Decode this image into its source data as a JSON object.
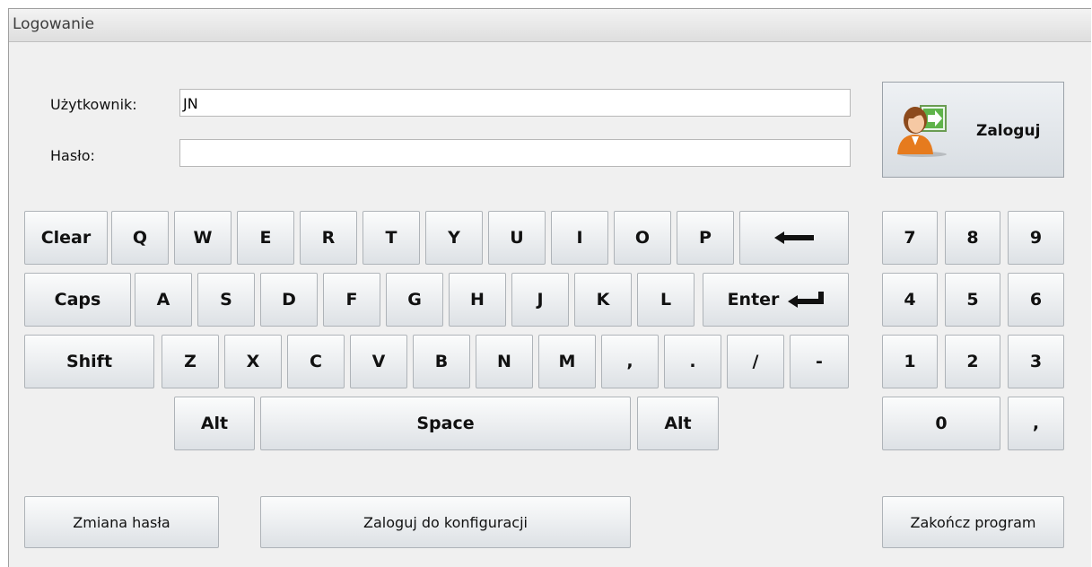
{
  "window": {
    "title": "Logowanie"
  },
  "form": {
    "user_label": "Użytkownik:",
    "user_value": "JN",
    "password_label": "Hasło:",
    "password_value": ""
  },
  "login_button": {
    "label": "Zaloguj",
    "icon": "user-login-icon"
  },
  "keyboard": {
    "row1": [
      "Clear",
      "Q",
      "W",
      "E",
      "R",
      "T",
      "Y",
      "U",
      "I",
      "O",
      "P"
    ],
    "backspace_icon": "backspace-arrow-icon",
    "row2": [
      "Caps",
      "A",
      "S",
      "D",
      "F",
      "G",
      "H",
      "J",
      "K",
      "L",
      "Enter"
    ],
    "enter_icon": "enter-arrow-icon",
    "row3": [
      "Shift",
      "Z",
      "X",
      "C",
      "V",
      "B",
      "N",
      "M",
      ",",
      ".",
      "/",
      "-"
    ],
    "row4": [
      "Alt",
      "Space",
      "Alt"
    ]
  },
  "numpad": {
    "rows": [
      [
        "7",
        "8",
        "9"
      ],
      [
        "4",
        "5",
        "6"
      ],
      [
        "1",
        "2",
        "3"
      ],
      [
        "0",
        ","
      ]
    ]
  },
  "bottom": {
    "change_password": "Zmiana hasła",
    "config_login": "Zaloguj do konfiguracji",
    "exit": "Zakończ program"
  }
}
